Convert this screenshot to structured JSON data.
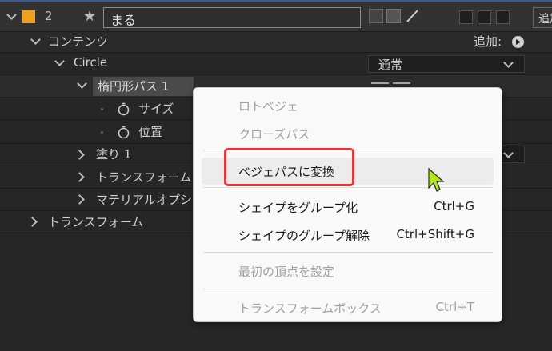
{
  "layer": {
    "number": "2",
    "name": "まる",
    "color": "#f0a020",
    "add_label": "追加"
  },
  "contents": {
    "label": "コンテンツ",
    "add_label": "追加:"
  },
  "circle": {
    "label": "Circle",
    "blend_mode": "通常"
  },
  "ellipse_path": {
    "label": "楕円形パス 1"
  },
  "size": {
    "label": "サイズ"
  },
  "position": {
    "label": "位置"
  },
  "fill": {
    "label": "塗り 1"
  },
  "transform_inner": {
    "label": "トランスフォーム"
  },
  "material": {
    "label": "マテリアルオプション"
  },
  "transform_outer": {
    "label": "トランスフォーム"
  },
  "context_menu": {
    "items": [
      {
        "label": "ロトベジェ",
        "shortcut": "",
        "disabled": true
      },
      {
        "label": "クローズパス",
        "shortcut": "",
        "disabled": true
      },
      {
        "label": "ベジェパスに変換",
        "shortcut": "",
        "disabled": false,
        "highlighted": true
      },
      {
        "label": "シェイプをグループ化",
        "shortcut": "Ctrl+G",
        "disabled": false
      },
      {
        "label": "シェイプのグループ解除",
        "shortcut": "Ctrl+Shift+G",
        "disabled": false
      },
      {
        "label": "最初の頂点を設定",
        "shortcut": "",
        "disabled": true
      },
      {
        "label": "トランスフォームボックス",
        "shortcut": "Ctrl+T",
        "disabled": true
      }
    ]
  },
  "colors": {
    "accent_red": "#e0393b",
    "cursor_green": "#b6e51b",
    "layer_orange": "#f0a020"
  }
}
